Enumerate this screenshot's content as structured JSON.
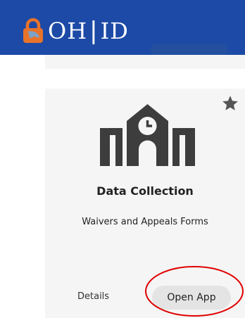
{
  "header": {
    "logo_oh": "OH",
    "logo_separator": "|",
    "logo_id": "ID",
    "logo_icon": "lock-icon",
    "background_color": "#1c4aa6"
  },
  "card": {
    "icon": "school-building-icon",
    "title": "Data Collection",
    "subtitle": "Waivers and Appeals Forms",
    "favorite_icon": "star-icon",
    "details_label": "Details",
    "open_label": "Open App"
  },
  "colors": {
    "accent": "#1c4aa6",
    "lock": "#e8732b",
    "card_background": "#f5f5f5",
    "annotation": "#e00000"
  }
}
